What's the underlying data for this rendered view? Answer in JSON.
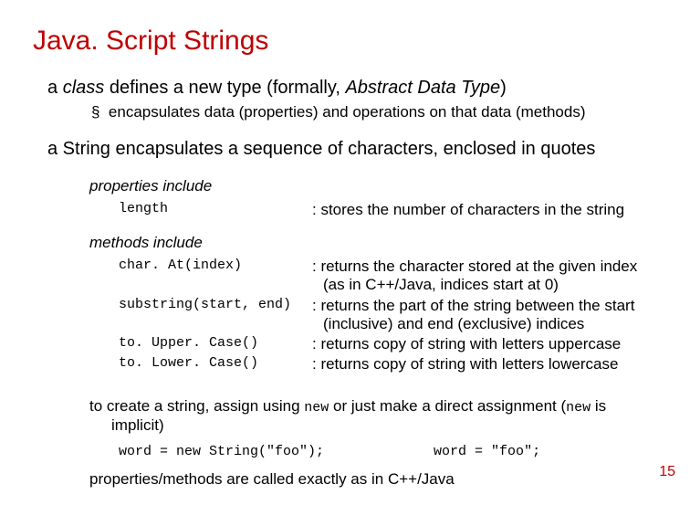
{
  "title": "Java. Script Strings",
  "classDefLine_pre": "a ",
  "classDefLine_it1": "class",
  "classDefLine_mid": " defines a new type (formally, ",
  "classDefLine_it2": "Abstract Data Type",
  "classDefLine_post": ")",
  "subBullet": "encapsulates data (properties) and operations on that data (methods)",
  "stringEncap": "a String encapsulates a sequence of characters, enclosed in quotes",
  "propertiesLabel": "properties include",
  "prop1_code": "length",
  "prop1_desc": ": stores the number of characters in the string",
  "methodsLabel": "methods include",
  "m1_code": "char. At(index)",
  "m1_desc1": ": returns the character stored at the given index",
  "m1_desc2": "(as in C++/Java, indices start at 0)",
  "m2_code": "substring(start, end)",
  "m2_desc1": ": returns the part of the string between the start",
  "m2_desc2": "(inclusive) and end (exclusive) indices",
  "m3_code": "to. Upper. Case()",
  "m3_desc": ": returns copy of string with letters uppercase",
  "m4_code": "to. Lower. Case()",
  "m4_desc": ": returns copy of string with letters lowercase",
  "create_pre": "to create a string, assign using ",
  "create_mono1": "new",
  "create_mid": " or just make a direct assignment (",
  "create_mono2": "new",
  "create_post": " is implicit)",
  "ex1": "word = new String(\"foo\");",
  "ex2": "word = \"foo\";",
  "finalNote": "properties/methods are called exactly as in C++/Java",
  "pageNumber": "15"
}
